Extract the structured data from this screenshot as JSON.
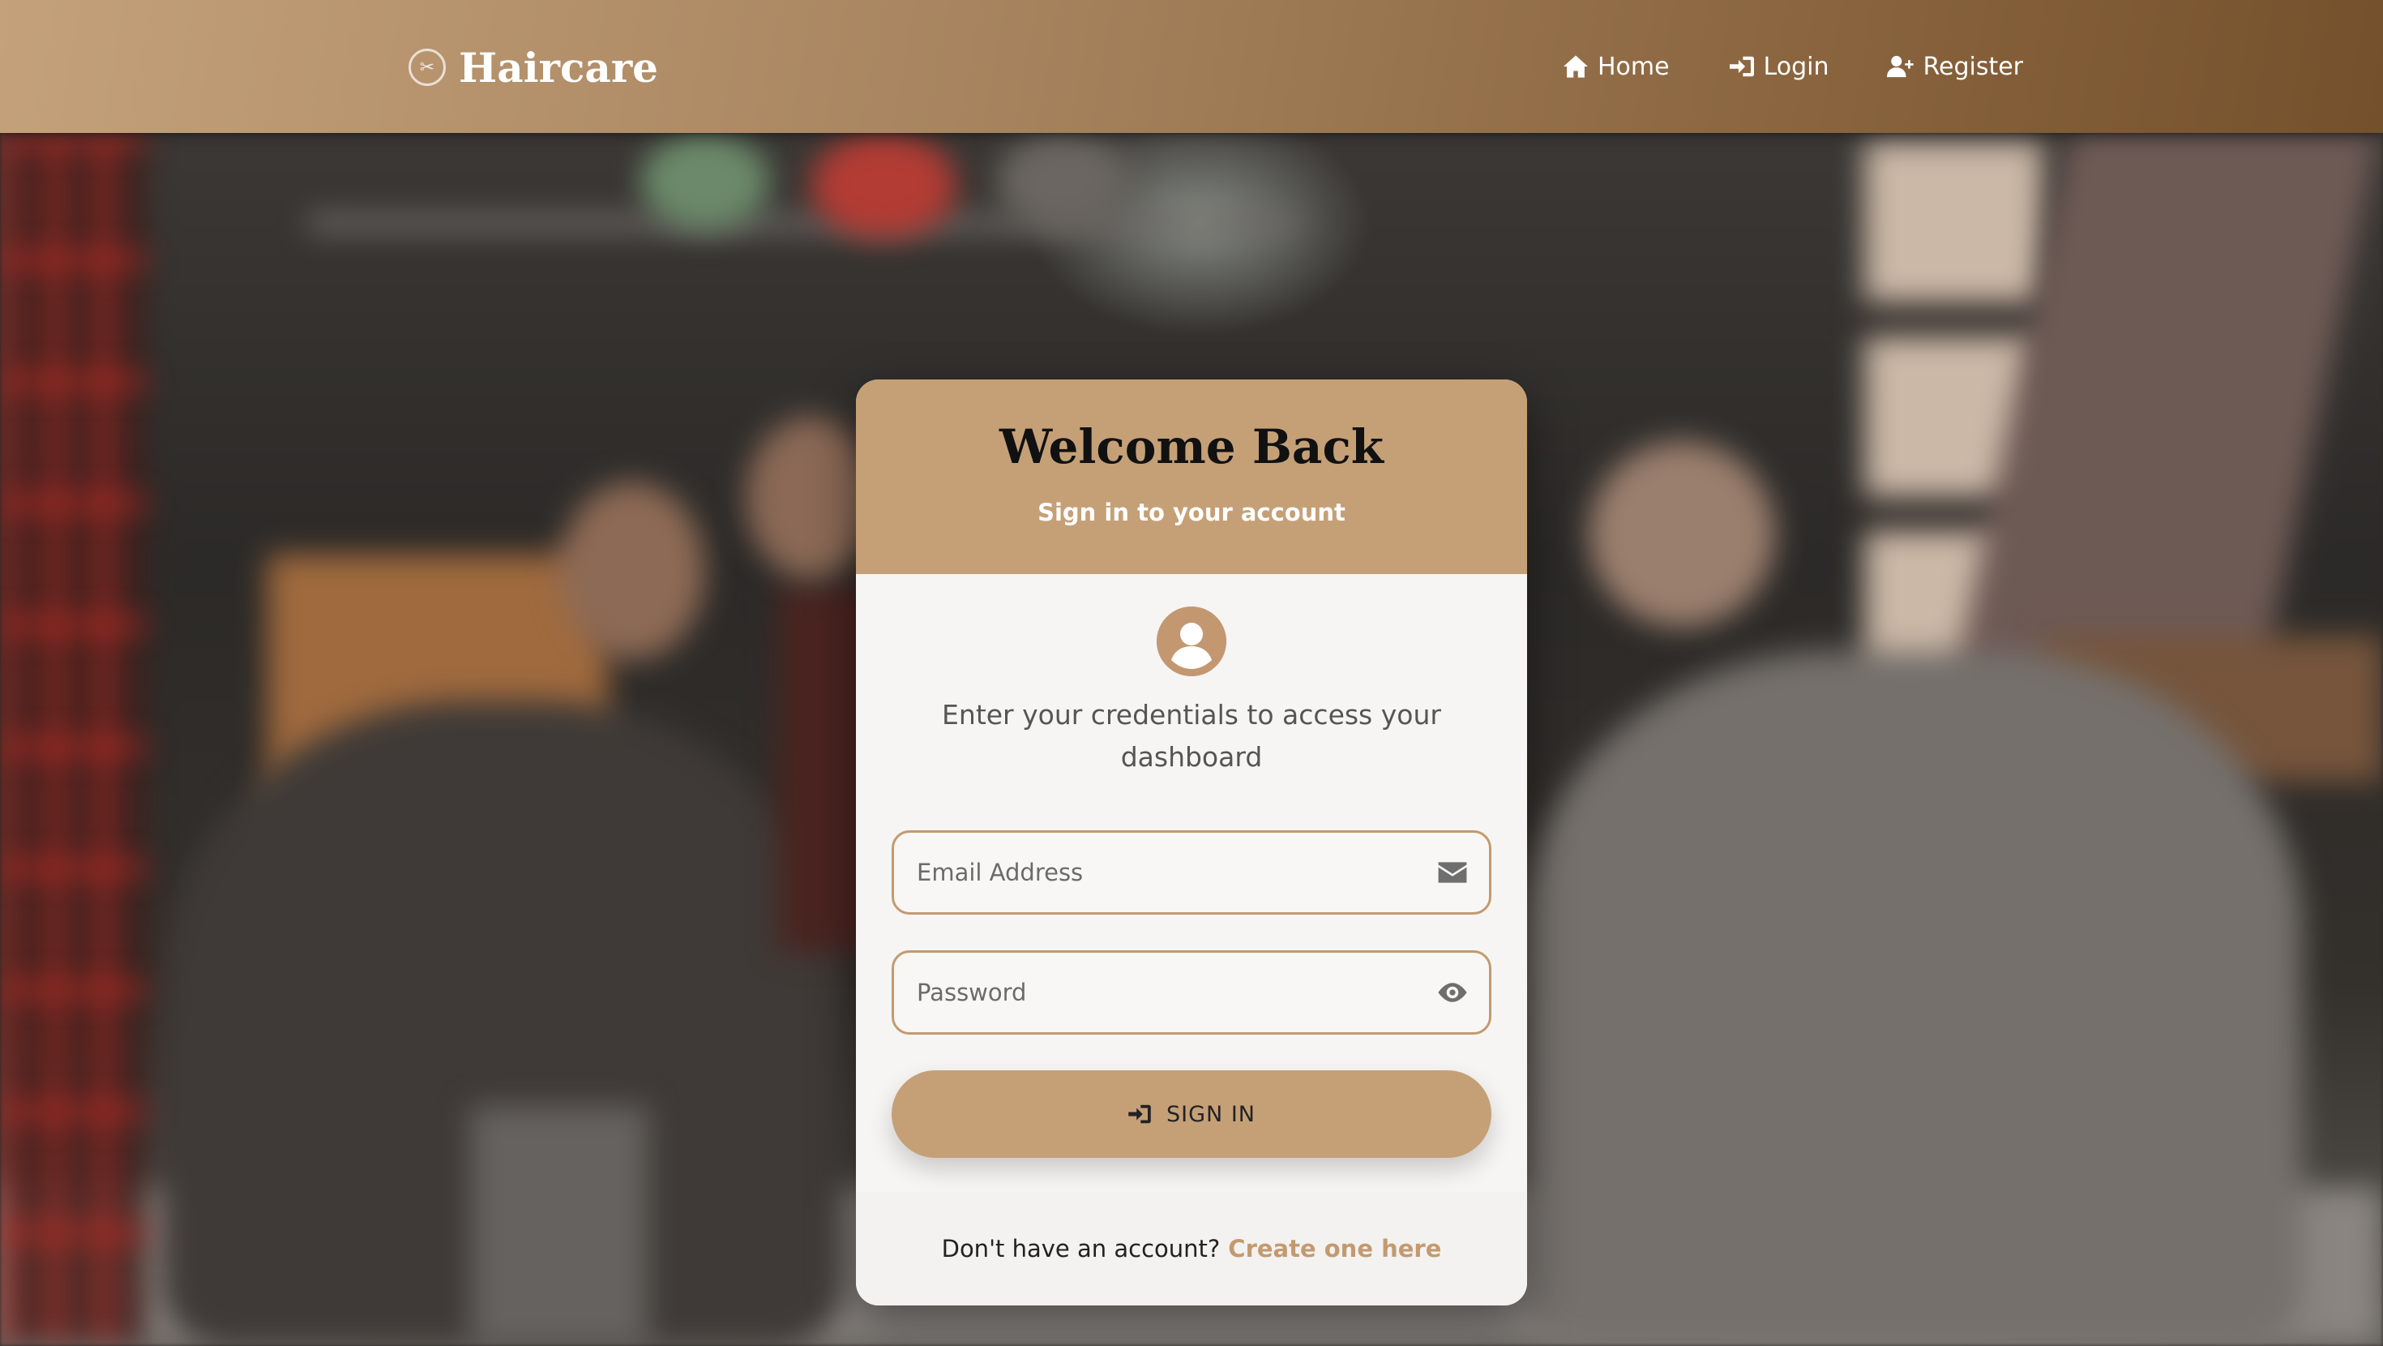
{
  "brand": {
    "name": "Haircare",
    "icon": "scissors-circle-icon"
  },
  "nav": {
    "items": [
      {
        "label": "Home",
        "icon": "home-icon"
      },
      {
        "label": "Login",
        "icon": "login-icon"
      },
      {
        "label": "Register",
        "icon": "user-plus-icon"
      }
    ]
  },
  "card": {
    "title": "Welcome Back",
    "subtitle": "Sign in to your account",
    "intro": "Enter your credentials to access your dashboard",
    "email": {
      "placeholder": "Email Address",
      "value": "",
      "icon": "envelope-icon"
    },
    "password": {
      "placeholder": "Password",
      "value": "",
      "icon": "eye-icon"
    },
    "signin_label": "SIGN IN",
    "footer_text": "Don't have an account?",
    "footer_link": "Create one here"
  },
  "colors": {
    "accent": "#c5a077",
    "navbar_start": "#c4a17a",
    "navbar_end": "#74502c",
    "link": "#c39a6f"
  }
}
